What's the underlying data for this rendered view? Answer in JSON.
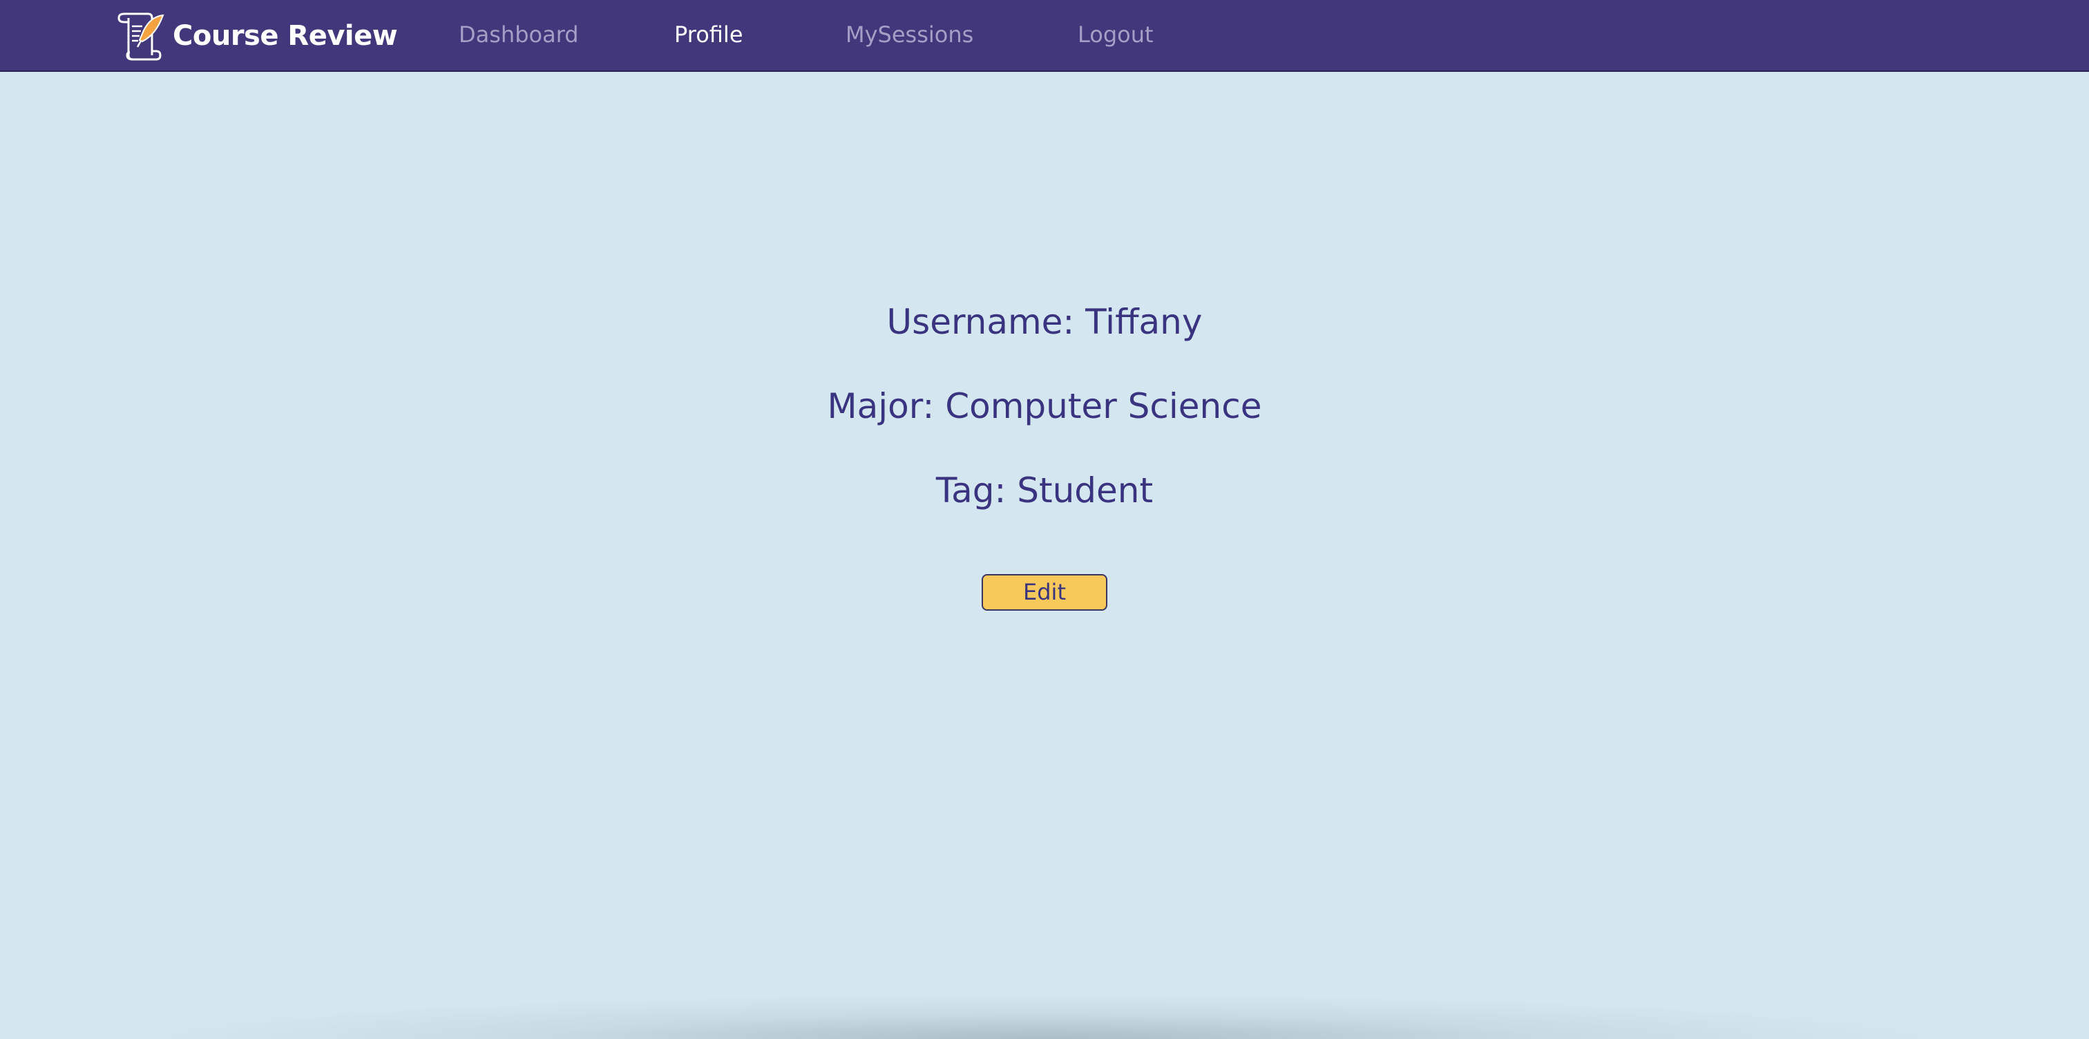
{
  "header": {
    "brand": "Course Review",
    "brand_icon": "scroll-quill-icon",
    "nav": [
      {
        "label": "Dashboard",
        "active": false
      },
      {
        "label": "Profile",
        "active": true
      },
      {
        "label": "MySessions",
        "active": false
      },
      {
        "label": "Logout",
        "active": false
      }
    ]
  },
  "profile": {
    "username": "Username: Tiffany",
    "major": "Major: Computer Science",
    "tag": "Tag: Student",
    "edit_label": "Edit"
  },
  "colors": {
    "navbar_bg": "#41377a",
    "page_bg": "#d4e7f0",
    "text": "#3a3480",
    "nav_inactive": "#a49fc6",
    "button_bg": "#f7c95b",
    "quill_accent": "#f4a340"
  }
}
